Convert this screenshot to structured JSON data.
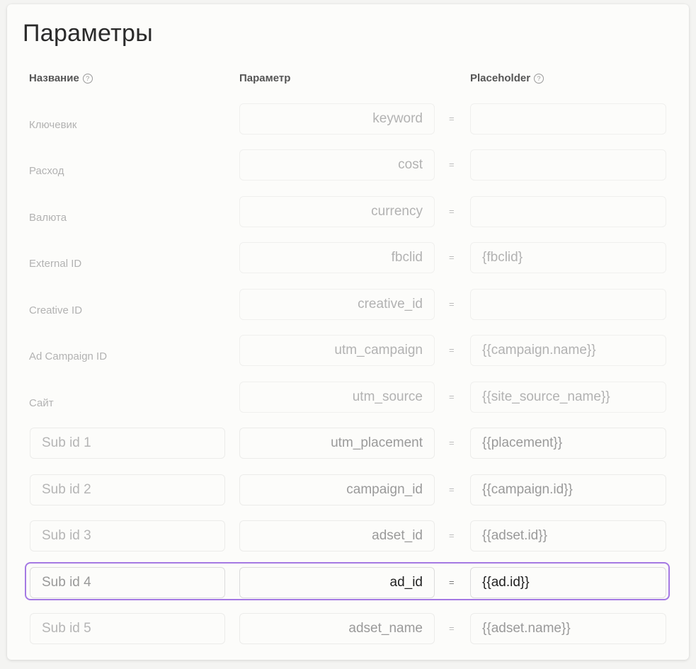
{
  "title": "Параметры",
  "columns": {
    "name": "Название",
    "param": "Параметр",
    "placeholder": "Placeholder"
  },
  "rows": [
    {
      "name": "Ключевик",
      "param": "keyword",
      "placeholder": ""
    },
    {
      "name": "Расход",
      "param": "cost",
      "placeholder": ""
    },
    {
      "name": "Валюта",
      "param": "currency",
      "placeholder": ""
    },
    {
      "name": "External ID",
      "param": "fbclid",
      "placeholder": "{fbclid}"
    },
    {
      "name": "Creative ID",
      "param": "creative_id",
      "placeholder": ""
    },
    {
      "name": "Ad Campaign ID",
      "param": "utm_campaign",
      "placeholder": "{{campaign.name}}"
    },
    {
      "name": "Сайт",
      "param": "utm_source",
      "placeholder": "{{site_source_name}}"
    },
    {
      "name_placeholder": "Sub id 1",
      "param": "utm_placement",
      "placeholder": "{{placement}}"
    },
    {
      "name_placeholder": "Sub id 2",
      "param": "campaign_id",
      "placeholder": "{{campaign.id}}"
    },
    {
      "name_placeholder": "Sub id 3",
      "param": "adset_id",
      "placeholder": "{{adset.id}}"
    },
    {
      "name_placeholder": "Sub id 4",
      "param": "ad_id",
      "placeholder": "{{ad.id}}",
      "highlighted": true
    },
    {
      "name_placeholder": "Sub id 5",
      "param": "adset_name",
      "placeholder": "{{adset.name}}"
    }
  ],
  "equals": "=",
  "help_icon": "?",
  "highlight_color": "#a479e3"
}
